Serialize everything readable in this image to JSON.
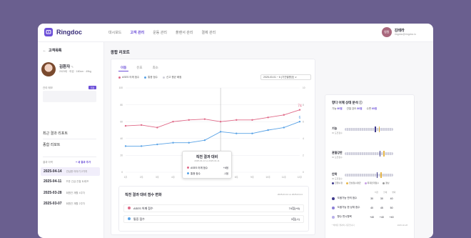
{
  "app": {
    "name": "Ringdoc",
    "brand_color": "#6c4fd8"
  },
  "nav": [
    "대시보드",
    "고객 관리",
    "운동 관리",
    "플랜서 관리",
    "결제 관리"
  ],
  "user": {
    "avatar": "청원",
    "name": "김태라",
    "email": "ringdoc@ringdoc.io"
  },
  "sidebar": {
    "back_label": "고객목록",
    "patient": {
      "name": "김환자",
      "meta": "2023세 · 여성 · 160cm · 49kg"
    },
    "memo_label": "관리 메모",
    "memo_button": "저장",
    "links": [
      "최근 결과 리포트",
      "종합 리포트"
    ],
    "history_label": "결과 이력",
    "history_add": "+ 새 결과 추가",
    "history": [
      {
        "date": "2025-04-14",
        "note": "관심한 이야기 2가지",
        "selected": true
      },
      {
        "date": "2025-04-11",
        "note": "꾸준 긴급 관찰 트레프",
        "selected": false
      },
      {
        "date": "2025-03-28",
        "note": "회원관 재활 4주차",
        "selected": false
      },
      {
        "date": "2025-03-07",
        "note": "회원관 재활 2주차",
        "selected": false
      }
    ]
  },
  "main": {
    "title": "종합 리포트",
    "tabs": [
      "이동",
      "유효",
      "최소"
    ],
    "legend": [
      "ASES 어깨 점수",
      "통증 점수",
      "신고 평균 배점"
    ],
    "dropdown": "2025-03-01 ~ 6 (기간별평균) ∨",
    "tooltip": {
      "title": "직전 결과 대비",
      "subtitle": "2025-04-14 vs 2025-04-11",
      "rows": [
        {
          "label": "ASES 어깨 점수",
          "value": "+6점",
          "color": "#e06a88"
        },
        {
          "label": "통증 점수",
          "value": "-1점",
          "color": "#5aa3e6"
        }
      ]
    },
    "comparison": {
      "title": "직전 결과 대비 점수 변화",
      "date": "2025-04-14 vs 2025-04-11",
      "rows": [
        {
          "label": "ASES 어깨 점수",
          "value": "74점(+6)",
          "color": "#e06a88"
        },
        {
          "label": "통증 점수",
          "value": "3점(-1)",
          "color": "#5aa3e6"
        }
      ]
    }
  },
  "chart_data": {
    "type": "line",
    "x": [
      "1주",
      "2주",
      "3주",
      "4주",
      "5주",
      "6주",
      "7주",
      "8주",
      "9주",
      "10주",
      "11주",
      "12주"
    ],
    "y_left_ticks": [
      "100",
      "80",
      "60",
      "40",
      "20",
      "0"
    ],
    "y_right_ticks": [
      "10",
      "8",
      "6",
      "4",
      "2",
      "0"
    ],
    "ylim_left": [
      0,
      100
    ],
    "ylim_right": [
      0,
      10
    ],
    "series": [
      {
        "name": "ASES 어깨 점수",
        "color": "#e06a88",
        "values": [
          55,
          56,
          53,
          60,
          62,
          63,
          60,
          62,
          62,
          65,
          68,
          74
        ],
        "end_label": "74"
      },
      {
        "name": "통증 점수",
        "color": "#5aa3e6",
        "axis": "right",
        "values": [
          3.1,
          3.1,
          3.3,
          3.5,
          3.5,
          3.8,
          4.8,
          4.6,
          4.6,
          5.0,
          5.3,
          6.0
        ],
        "end_label": "6"
      }
    ],
    "highlight_index": 6
  },
  "right_panel": {
    "title": "향다 어깨 상태 분석 ⓘ",
    "stats": [
      {
        "label": "기능",
        "value": "60점"
      },
      {
        "label": "관절 강도",
        "value": "80점"
      },
      {
        "label": "수면",
        "value": "60점"
      },
      {
        "label": "변화",
        "value": "60점"
      }
    ],
    "categories": [
      {
        "name": "기능",
        "sub": "ID 도전점수",
        "markers": [
          0.62,
          0.7
        ]
      },
      {
        "name": "관절강한",
        "sub": "ID 도전점수",
        "markers": [
          0.72,
          0.8
        ]
      },
      {
        "name": "안락",
        "sub": "ID 도전점수",
        "markers": [
          0.66,
          0.74
        ]
      }
    ],
    "legend": [
      {
        "label": "진행수정",
        "color": "#3f3a8c"
      },
      {
        "label": "전성점수평균",
        "color": "#e8b84a"
      },
      {
        "label": "최대만개점수",
        "color": "#c8a0e6"
      },
      {
        "label": "결상",
        "color": "#999999"
      }
    ],
    "table_head": [
      "이전",
      "현재",
      "변화"
    ],
    "table": [
      {
        "label": "도움가능 만의 점수",
        "color": "#3f3a8c",
        "a": "30",
        "b": "30",
        "c": "40"
      },
      {
        "label": "도움가능 한 상위 점수",
        "color": "#8b7fd6",
        "a": "40",
        "b": "45",
        "c": "50"
      },
      {
        "label": "향수 변시항목",
        "color": "#b9b0ea",
        "a": "+40",
        "b": "+40",
        "c": "+40"
      }
    ],
    "footer": "* 해석은 결과의 기준입니다",
    "footer_date": "2025-02-28"
  }
}
